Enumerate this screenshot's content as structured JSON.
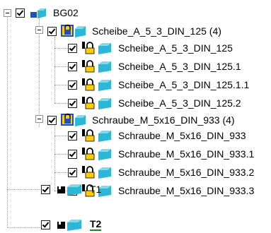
{
  "tree": {
    "root": {
      "label": "BG02"
    },
    "groups": [
      {
        "label": "Scheibe_A_5_3_DIN_125 (4)",
        "items": [
          "Scheibe_A_5_3_DIN_125",
          "Scheibe_A_5_3_DIN_125.1",
          "Scheibe_A_5_3_DIN_125.1.1",
          "Scheibe_A_5_3_DIN_125.2"
        ]
      },
      {
        "label": "Schraube_M_5x16_DIN_933 (4)",
        "items": [
          "Schraube_M_5x16_DIN_933",
          "Schraube_M_5x16_DIN_933.1",
          "Schraube_M_5x16_DIN_933.2",
          "Schraube_M_5x16_DIN_933.3"
        ]
      }
    ],
    "parts": [
      {
        "label": "T1"
      },
      {
        "label": "T2"
      }
    ]
  },
  "colors": {
    "part_cyan": "#2bb8d8",
    "assembly_blue": "#1f4fbf",
    "lock_yellow": "#ffcc00",
    "t2_underline": "#1b8a1b"
  }
}
